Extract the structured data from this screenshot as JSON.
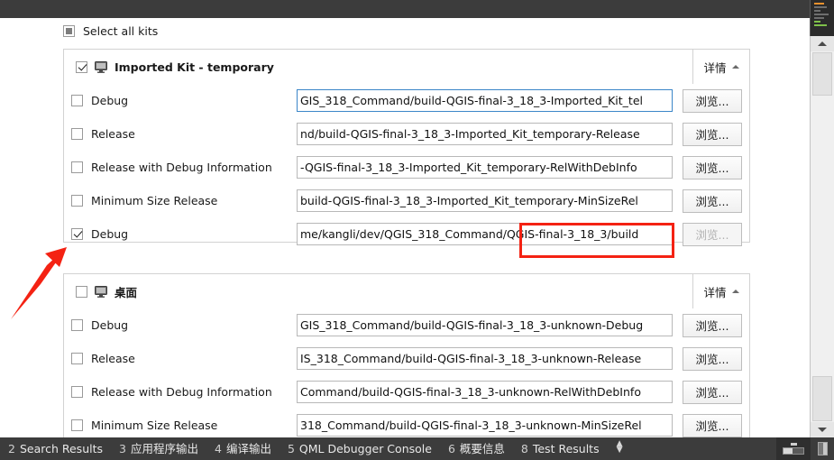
{
  "select_all": {
    "label": "Select all kits",
    "state": "partial"
  },
  "kits": [
    {
      "name": "Imported Kit - temporary",
      "icon": "monitor-icon",
      "checked": true,
      "details_label": "详情",
      "configs": [
        {
          "label": "Debug",
          "checked": false,
          "path": "GIS_318_Command/build-QGIS-final-3_18_3-Imported_Kit_tel",
          "browse_label": "浏览...",
          "browse_disabled": false,
          "focused": true
        },
        {
          "label": "Release",
          "checked": false,
          "path": "nd/build-QGIS-final-3_18_3-Imported_Kit_temporary-Release",
          "browse_label": "浏览...",
          "browse_disabled": false,
          "focused": false
        },
        {
          "label": "Release with Debug Information",
          "checked": false,
          "path": "-QGIS-final-3_18_3-Imported_Kit_temporary-RelWithDebInfo",
          "browse_label": "浏览...",
          "browse_disabled": false,
          "focused": false
        },
        {
          "label": "Minimum Size Release",
          "checked": false,
          "path": "build-QGIS-final-3_18_3-Imported_Kit_temporary-MinSizeRel",
          "browse_label": "浏览...",
          "browse_disabled": false,
          "focused": false
        },
        {
          "label": "Debug",
          "checked": true,
          "path": "me/kangli/dev/QGIS_318_Command/QGIS-final-3_18_3/build",
          "browse_label": "浏览...",
          "browse_disabled": true,
          "focused": false
        }
      ]
    },
    {
      "name": "桌面",
      "icon": "monitor-icon",
      "checked": false,
      "details_label": "详情",
      "configs": [
        {
          "label": "Debug",
          "checked": false,
          "path": "GIS_318_Command/build-QGIS-final-3_18_3-unknown-Debug",
          "browse_label": "浏览...",
          "browse_disabled": false,
          "focused": false
        },
        {
          "label": "Release",
          "checked": false,
          "path": "IS_318_Command/build-QGIS-final-3_18_3-unknown-Release",
          "browse_label": "浏览...",
          "browse_disabled": false,
          "focused": false
        },
        {
          "label": "Release with Debug Information",
          "checked": false,
          "path": "Command/build-QGIS-final-3_18_3-unknown-RelWithDebInfo",
          "browse_label": "浏览...",
          "browse_disabled": false,
          "focused": false
        },
        {
          "label": "Minimum Size Release",
          "checked": false,
          "path": "318_Command/build-QGIS-final-3_18_3-unknown-MinSizeRel",
          "browse_label": "浏览...",
          "browse_disabled": false,
          "focused": false
        }
      ]
    }
  ],
  "annotations": {
    "highlight_color": "#f42213",
    "arrow_color": "#f42213",
    "highlight_target": "me/kangli/dev/QGIS_318_Command/QGIS-final-3_18_3/build"
  },
  "statusbar": {
    "items": [
      {
        "num": "2",
        "label": "Search Results"
      },
      {
        "num": "3",
        "label": "应用程序输出"
      },
      {
        "num": "4",
        "label": "编译输出"
      },
      {
        "num": "5",
        "label": "QML Debugger Console"
      },
      {
        "num": "6",
        "label": "概要信息"
      },
      {
        "num": "8",
        "label": "Test Results"
      }
    ],
    "updown_icon": "up-down-arrows-icon",
    "progress_icon": "build-progress-icon",
    "panel_icon": "toggle-sidebar-icon"
  }
}
